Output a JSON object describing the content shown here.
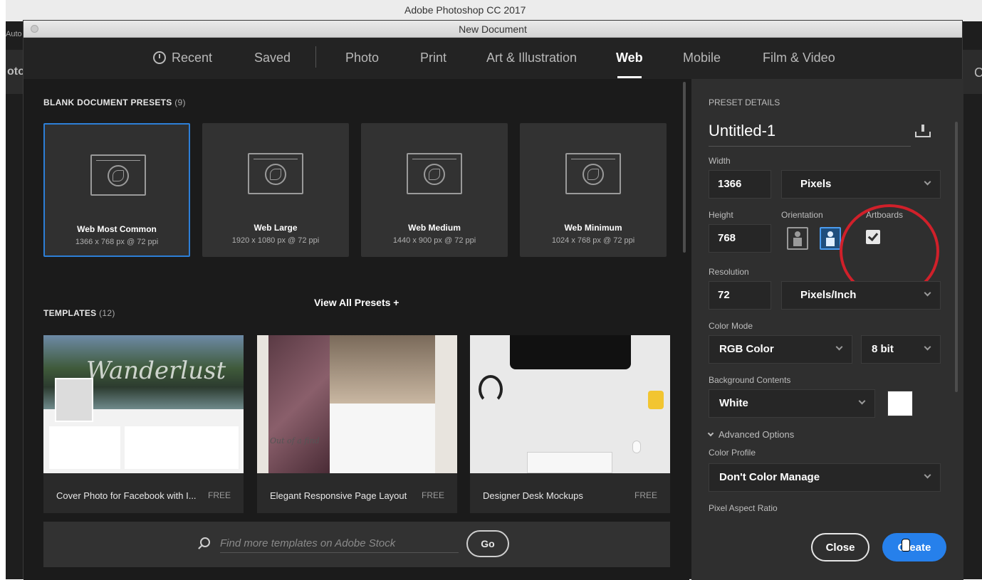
{
  "app": {
    "title": "Adobe Photoshop CC 2017",
    "left_edge_top": "Auto",
    "left_edge_mid": "oto",
    "right_edge": "C"
  },
  "dialog": {
    "title": "New Document",
    "tabs": [
      {
        "label": "Recent",
        "icon": "clock-icon"
      },
      {
        "label": "Saved"
      },
      {
        "label": "Photo"
      },
      {
        "label": "Print"
      },
      {
        "label": "Art & Illustration"
      },
      {
        "label": "Web",
        "active": true
      },
      {
        "label": "Mobile"
      },
      {
        "label": "Film & Video"
      }
    ]
  },
  "presets": {
    "title": "BLANK DOCUMENT PRESETS",
    "count": "(9)",
    "items": [
      {
        "name": "Web Most Common",
        "size": "1366 x 768 px @ 72 ppi",
        "selected": true
      },
      {
        "name": "Web Large",
        "size": "1920 x 1080 px @ 72 ppi"
      },
      {
        "name": "Web Medium",
        "size": "1440 x 900 px @ 72 ppi"
      },
      {
        "name": "Web Minimum",
        "size": "1024 x 768 px @ 72 ppi"
      }
    ],
    "view_all": "View All Presets +"
  },
  "templates": {
    "title": "TEMPLATES",
    "count": "(12)",
    "items": [
      {
        "name": "Cover Photo for Facebook with I...",
        "price": "FREE",
        "thumb_text": "Wanderlust"
      },
      {
        "name": "Elegant Responsive Page Layout",
        "price": "FREE",
        "thumb_text": "Out of a find"
      },
      {
        "name": "Designer Desk Mockups",
        "price": "FREE"
      }
    ]
  },
  "stock": {
    "placeholder": "Find more templates on Adobe Stock",
    "go_label": "Go"
  },
  "details": {
    "header": "PRESET DETAILS",
    "name": "Untitled-1",
    "width_label": "Width",
    "width_value": "1366",
    "width_unit": "Pixels",
    "height_label": "Height",
    "height_value": "768",
    "orientation_label": "Orientation",
    "artboards_label": "Artboards",
    "artboards_checked": true,
    "resolution_label": "Resolution",
    "resolution_value": "72",
    "resolution_unit": "Pixels/Inch",
    "color_mode_label": "Color Mode",
    "color_mode": "RGB Color",
    "bit_depth": "8 bit",
    "bg_label": "Background Contents",
    "bg_value": "White",
    "bg_color": "#ffffff",
    "advanced_label": "Advanced Options",
    "color_profile_label": "Color Profile",
    "color_profile": "Don't Color Manage",
    "pixel_aspect_label": "Pixel Aspect Ratio",
    "close_label": "Close",
    "create_label": "Create"
  },
  "colors": {
    "accent": "#2680eb",
    "highlight_circle": "#d0202a",
    "dialog_bg": "#1b1b1b",
    "panel_bg": "#2f2f2f"
  }
}
